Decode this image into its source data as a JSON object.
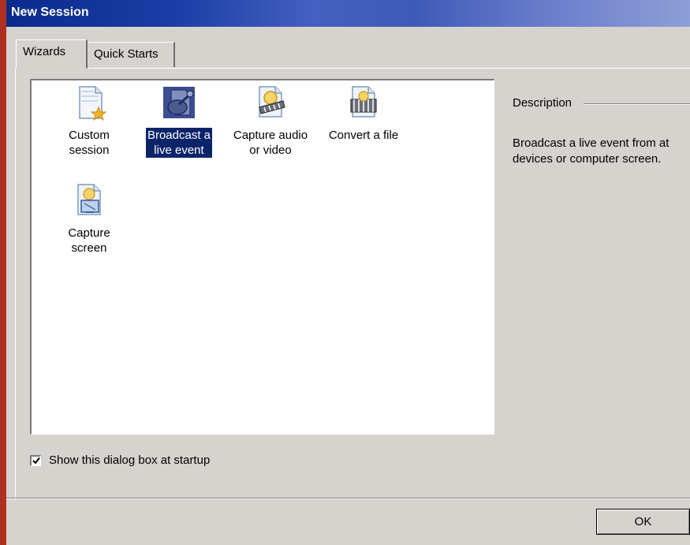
{
  "window": {
    "title": "New Session"
  },
  "tabs": [
    {
      "label": "Wizards",
      "active": true
    },
    {
      "label": "Quick Starts",
      "active": false
    }
  ],
  "wizards": [
    {
      "label_line1": "Custom",
      "label_line2": "session",
      "icon": "custom-session-icon",
      "selected": false
    },
    {
      "label_line1": "Broadcast a",
      "label_line2": "live event",
      "icon": "broadcast-icon",
      "selected": true
    },
    {
      "label_line1": "Capture audio",
      "label_line2": "or video",
      "icon": "capture-audio-video-icon",
      "selected": false
    },
    {
      "label_line1": "Convert a file",
      "label_line2": "",
      "icon": "convert-file-icon",
      "selected": false
    },
    {
      "label_line1": "Capture",
      "label_line2": "screen",
      "icon": "capture-screen-icon",
      "selected": false
    }
  ],
  "description": {
    "header": "Description",
    "text_line1": "Broadcast a live event from at",
    "text_line2": "devices or computer screen."
  },
  "startup_checkbox": {
    "label": "Show this dialog box at startup",
    "checked": true
  },
  "buttons": {
    "ok": "OK"
  },
  "colors": {
    "selection": "#0a246a",
    "titlebar": "#0a2a8c",
    "face": "#d6d3ce"
  }
}
